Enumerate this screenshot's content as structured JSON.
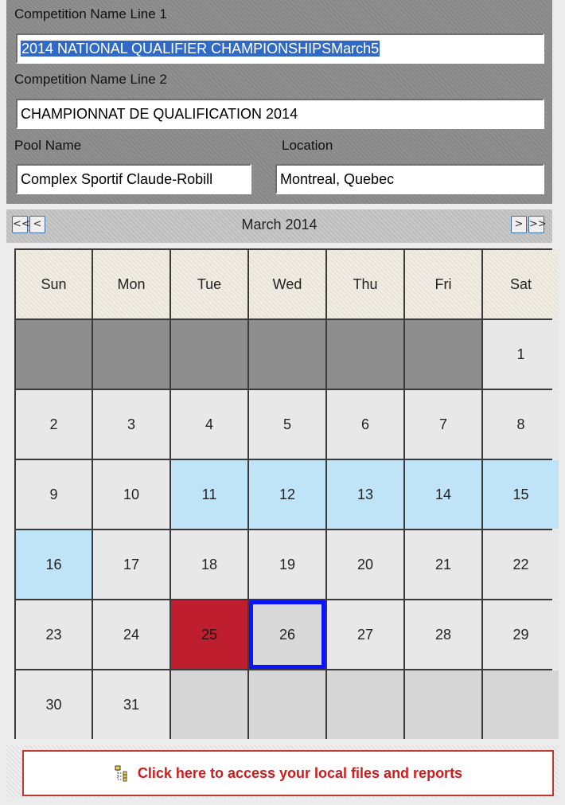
{
  "form": {
    "name1_label": "Competition Name Line 1",
    "name1_value": "2014 NATIONAL QUALIFIER CHAMPIONSHIPSMarch5",
    "name2_label": "Competition Name Line 2",
    "name2_value": "CHAMPIONNAT DE QUALIFICATION 2014",
    "pool_label": "Pool Name",
    "pool_value": "Complex Sportif Claude-Robill",
    "location_label": "Location",
    "location_value": "Montreal, Quebec"
  },
  "calendar": {
    "title": "March 2014",
    "nav": {
      "prev_year": "<<",
      "prev_month": "<",
      "next_month": ">",
      "next_year": ">>"
    },
    "weekdays": [
      "Sun",
      "Mon",
      "Tue",
      "Wed",
      "Thu",
      "Fri",
      "Sat"
    ],
    "weeks": [
      [
        "",
        "",
        "",
        "",
        "",
        "",
        "1"
      ],
      [
        "2",
        "3",
        "4",
        "5",
        "6",
        "7",
        "8"
      ],
      [
        "9",
        "10",
        "11",
        "12",
        "13",
        "14",
        "15"
      ],
      [
        "16",
        "17",
        "18",
        "19",
        "20",
        "21",
        "22"
      ],
      [
        "23",
        "24",
        "25",
        "26",
        "27",
        "28",
        "29"
      ],
      [
        "30",
        "31",
        "",
        "",
        "",
        "",
        ""
      ]
    ],
    "highlighted_days": [
      "11",
      "12",
      "13",
      "14",
      "15",
      "16"
    ],
    "red_day": "25",
    "selected_day": "26",
    "colors": {
      "highlight": "#bfe3f7",
      "red": "#bf1e2e",
      "selection_border": "#0a14ff"
    }
  },
  "footer": {
    "link_label": "Click here to access your local files and reports",
    "icon": "tree-structure-icon"
  }
}
